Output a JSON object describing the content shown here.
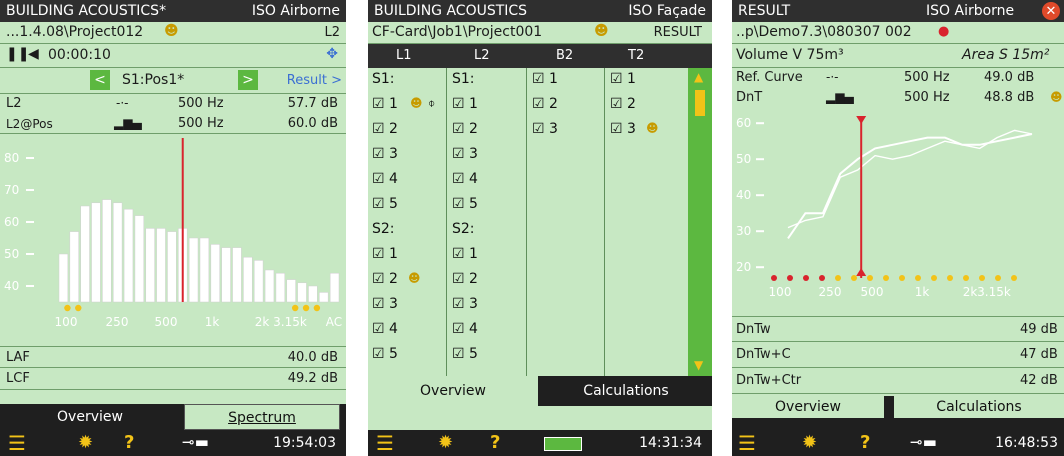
{
  "p1": {
    "header_title": "BUILDING ACOUSTICS*",
    "header_mode": "ISO Airborne",
    "path": "...1.4.08\\Project012",
    "path_tag": "L2",
    "elapsed": "00:00:10",
    "position": "S1:Pos1*",
    "result_link": "Result >",
    "m1_label": "L2",
    "m1_freq": "500 Hz",
    "m1_value": "57.7 dB",
    "m2_label": "L2@Pos",
    "m2_freq": "500 Hz",
    "m2_value": "60.0 dB",
    "y_ticks": [
      "80",
      "70",
      "60",
      "50",
      "40"
    ],
    "x_ticks": [
      "100",
      "250",
      "500",
      "1k",
      "2k",
      "3.15k",
      "AC"
    ],
    "laf_label": "LAF",
    "laf_value": "40.0 dB",
    "lcf_label": "LCF",
    "lcf_value": "49.2 dB",
    "tab_overview": "Overview",
    "tab_spectrum": "Spectrum",
    "clock": "19:54:03"
  },
  "p2": {
    "header_title": "BUILDING ACOUSTICS",
    "header_mode": "ISO Façade",
    "path": "CF-Card\\Job1\\Project001",
    "path_tag": "RESULT",
    "columns": [
      "L1",
      "L2",
      "B2",
      "T2"
    ],
    "l1": [
      "S1:",
      "☑ 1",
      "☑ 2",
      "☑ 3",
      "☑ 4",
      "☑ 5",
      "S2:",
      "☑ 1",
      "☑ 2",
      "☑ 3",
      "☑ 4",
      "☑ 5"
    ],
    "l2": [
      "S1:",
      "☑ 1",
      "☑ 2",
      "☑ 3",
      "☑ 4",
      "☑ 5",
      "S2:",
      "☑ 1",
      "☑ 2",
      "☑ 3",
      "☑ 4",
      "☑ 5"
    ],
    "b2": [
      "☑ 1",
      "☑ 2",
      "☑ 3"
    ],
    "t2": [
      "☑ 1",
      "☑ 2",
      "☑ 3"
    ],
    "tab_overview": "Overview",
    "tab_calculations": "Calculations",
    "clock": "14:31:34"
  },
  "p3": {
    "header_title": "RESULT",
    "header_mode": "ISO Airborne",
    "path": "..p\\Demo7.3\\080307 002",
    "volume": "Volume V 75m³",
    "area": "Area S 15m²",
    "m1_label": "Ref. Curve",
    "m1_freq": "500 Hz",
    "m1_value": "49.0 dB",
    "m2_label": "DnT",
    "m2_freq": "500 Hz",
    "m2_value": "48.8 dB",
    "y_ticks": [
      "60",
      "50",
      "40",
      "30",
      "20"
    ],
    "x_ticks": [
      "100",
      "250",
      "500",
      "1k",
      "2k",
      "3.15k"
    ],
    "r1_label": "DnTw",
    "r1_value": "49 dB",
    "r2_label": "DnTw+C",
    "r2_value": "47 dB",
    "r3_label": "DnTw+Ctr",
    "r3_value": "42 dB",
    "tab_overview": "Overview",
    "tab_calculations": "Calculations",
    "clock": "16:48:53"
  },
  "chart_data": [
    {
      "type": "bar",
      "ylim": [
        35,
        85
      ],
      "grid": false,
      "values": [
        50,
        57,
        65,
        66,
        67,
        66,
        64,
        62,
        58,
        58,
        57,
        58,
        55,
        55,
        53,
        52,
        52,
        49,
        48,
        45,
        44,
        42,
        41,
        40,
        38,
        44
      ],
      "cursor": "500 Hz"
    },
    {
      "type": "line",
      "ylim": [
        17,
        62
      ],
      "grid": false,
      "series": [
        {
          "values": [
            28,
            35,
            35,
            46,
            50,
            53,
            54,
            55,
            56,
            56,
            54,
            54,
            55,
            56,
            57
          ]
        },
        {
          "values": [
            31,
            33,
            34,
            45,
            47,
            51,
            50,
            51,
            53,
            55,
            54,
            53,
            56,
            58,
            57
          ]
        }
      ],
      "cursor": "500 Hz"
    }
  ],
  "colors": {
    "header": "#2f2f2f",
    "panel": "#c7e8c3",
    "accent": "#d9232d",
    "button": "#5cb840",
    "link": "#3b6fd3",
    "marker": "#f2c318"
  }
}
